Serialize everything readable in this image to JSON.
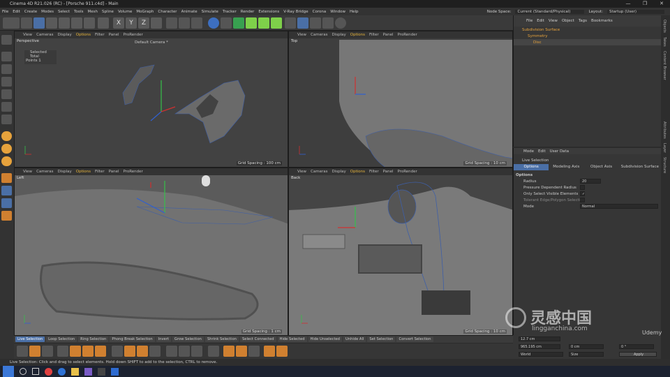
{
  "window": {
    "title": "Cinema 4D R21.026 (RC) - [Porsche 911.c4d] - Main",
    "controls": [
      "—",
      "❐",
      "✕"
    ]
  },
  "menu": [
    "File",
    "Edit",
    "Create",
    "Modes",
    "Select",
    "Tools",
    "Mesh",
    "Spline",
    "Volume",
    "MoGraph",
    "Character",
    "Animate",
    "Simulate",
    "Tracker",
    "Render",
    "Extensions",
    "V-Ray Bridge",
    "Corona",
    "Window",
    "Help"
  ],
  "node_space": {
    "label": "Node Space:",
    "value": "Current (Standard/Physical)"
  },
  "layout": {
    "label": "Layout:",
    "value": "Startup (User)"
  },
  "viewport_menu": [
    "View",
    "Cameras",
    "Display",
    "Options",
    "Filter",
    "Panel",
    "ProRender"
  ],
  "viewports": {
    "top_left": {
      "name": "Perspective",
      "camera": "Default Camera *",
      "info_title": "Selected Total",
      "info_points_label": "Points",
      "info_points_value": "1",
      "grid": "Grid Spacing : 100 cm"
    },
    "top_right": {
      "name": "Top",
      "grid": "Grid Spacing : 10 cm"
    },
    "bottom_left": {
      "name": "Left",
      "grid": "Grid Spacing : 1 cm"
    },
    "bottom_right": {
      "name": "Back",
      "grid": "Grid Spacing : 10 cm"
    }
  },
  "object_manager": {
    "menu": [
      "File",
      "Edit",
      "View",
      "Object",
      "Tags",
      "Bookmarks"
    ],
    "items": [
      {
        "label": "Subdivision Surface",
        "color": "#e6a23c"
      },
      {
        "label": "Symmetry",
        "color": "#e6a23c"
      },
      {
        "label": "Disc",
        "color": "#e6a23c"
      }
    ]
  },
  "attribute_manager": {
    "menu": [
      "Mode",
      "Edit",
      "User Data"
    ],
    "title": "Live Selection",
    "tabs": [
      "Options",
      "Modeling Axis",
      "Object Axis",
      "Subdivision Surface"
    ],
    "section": "Options",
    "fields": [
      {
        "label": "Radius",
        "value": "20"
      },
      {
        "label": "Pressure Dependent Radius",
        "checked": false
      },
      {
        "label": "Only Select Visible Elements",
        "checked": true
      },
      {
        "label": "Tolerant Edge/Polygon Selection",
        "checked": false
      },
      {
        "label": "Mode",
        "value": "Normal"
      }
    ]
  },
  "right_tabs": [
    "Objects",
    "Takes",
    "Content Browser",
    "Attributes",
    "Layer",
    "Structure"
  ],
  "selection_bar": [
    "Live Selection",
    "Loop Selection",
    "Ring Selection",
    "Phong Break Selection",
    "Invert",
    "Grow Selection",
    "Shrink Selection",
    "Select Connected",
    "Hide Selected",
    "Hide Unselected",
    "Unhide All",
    "Set Selection",
    "Convert Selection"
  ],
  "coords": {
    "x1": "12.7 cm",
    "x2": "965.195 cm",
    "y2": "0 cm",
    "z": "0 °",
    "world": "World",
    "size": "Size",
    "apply": "Apply"
  },
  "status": "Live Selection: Click and drag to select elements. Hold down SHIFT to add to the selection, CTRL to remove.",
  "watermark": {
    "cn": "灵感中国",
    "url": "lingganchina.com",
    "udemy": "Udemy"
  },
  "colors": {
    "accent": "#e6b43c",
    "selection": "#4a6fa6",
    "wire": "#3e5fa8"
  }
}
